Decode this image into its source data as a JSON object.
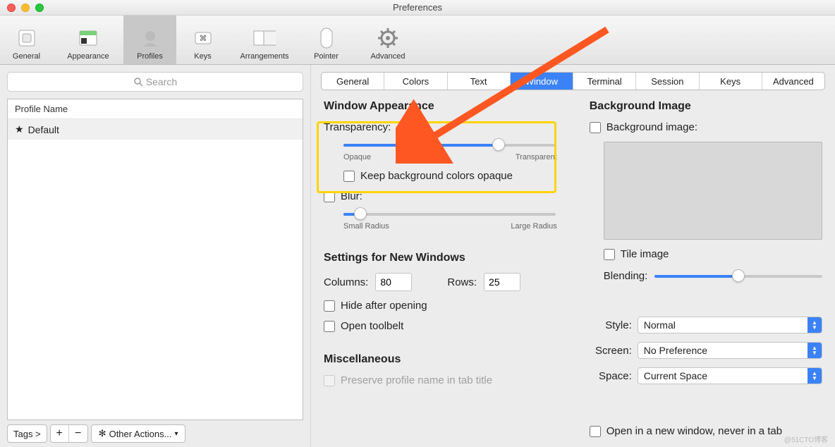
{
  "window_title": "Preferences",
  "toolbar": [
    {
      "label": "General"
    },
    {
      "label": "Appearance"
    },
    {
      "label": "Profiles"
    },
    {
      "label": "Keys"
    },
    {
      "label": "Arrangements"
    },
    {
      "label": "Pointer"
    },
    {
      "label": "Advanced"
    }
  ],
  "search_placeholder": "Search",
  "profile_list": {
    "header": "Profile Name",
    "items": [
      "Default"
    ]
  },
  "bottom_bar": {
    "tags": "Tags >",
    "other_actions": "Other Actions..."
  },
  "tabs": [
    "General",
    "Colors",
    "Text",
    "Window",
    "Terminal",
    "Session",
    "Keys",
    "Advanced"
  ],
  "active_tab": "Window",
  "appearance": {
    "heading": "Window Appearance",
    "transparency_label": "Transparency:",
    "transparency_value": 73,
    "slider_min_label": "Opaque",
    "slider_max_label": "Transparent",
    "keep_bg_opaque": "Keep background colors opaque",
    "blur_label": "Blur:",
    "blur_value": 8,
    "blur_min_label": "Small Radius",
    "blur_max_label": "Large Radius"
  },
  "new_windows": {
    "heading": "Settings for New Windows",
    "columns_label": "Columns:",
    "columns_value": "80",
    "rows_label": "Rows:",
    "rows_value": "25",
    "hide_after_opening": "Hide after opening",
    "open_toolbelt": "Open toolbelt"
  },
  "misc": {
    "heading": "Miscellaneous",
    "preserve_profile": "Preserve profile name in tab title"
  },
  "bg_image": {
    "heading": "Background Image",
    "bg_image_label": "Background image:",
    "tile_label": "Tile image",
    "blending_label": "Blending:",
    "blending_value": 50
  },
  "style_section": {
    "style_label": "Style:",
    "style_value": "Normal",
    "screen_label": "Screen:",
    "screen_value": "No Preference",
    "space_label": "Space:",
    "space_value": "Current Space"
  },
  "open_new_window": "Open in a new window, never in a tab",
  "watermark": "@51CTO博客"
}
